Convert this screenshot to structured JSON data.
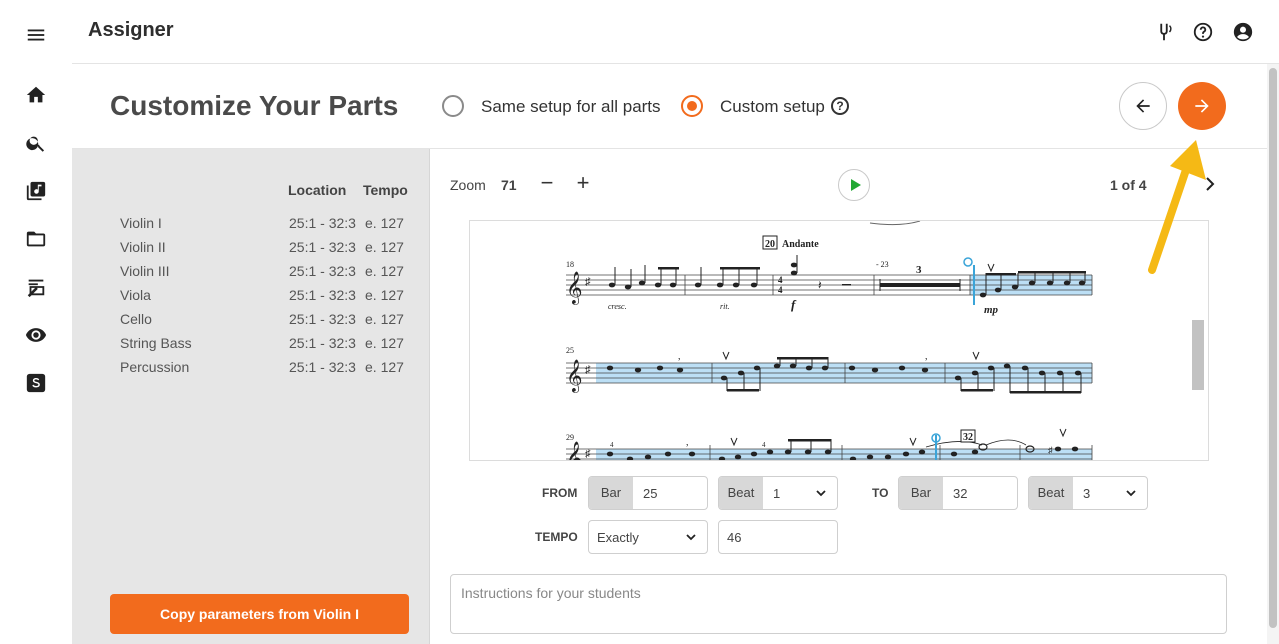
{
  "app": {
    "title": "Assigner"
  },
  "page": {
    "title": "Customize Your Parts"
  },
  "setup": {
    "option_same": "Same setup for all parts",
    "option_custom": "Custom setup",
    "selected": "custom",
    "help_glyph": "?"
  },
  "parts_table": {
    "headers": {
      "location": "Location",
      "tempo": "Tempo"
    },
    "rows": [
      {
        "name": "Violin I",
        "location": "25:1 - 32:3",
        "tempo": "e. 127"
      },
      {
        "name": "Violin II",
        "location": "25:1 - 32:3",
        "tempo": "e. 127"
      },
      {
        "name": "Violin III",
        "location": "25:1 - 32:3",
        "tempo": "e. 127"
      },
      {
        "name": "Viola",
        "location": "25:1 - 32:3",
        "tempo": "e. 127"
      },
      {
        "name": "Cello",
        "location": "25:1 - 32:3",
        "tempo": "e. 127"
      },
      {
        "name": "String Bass",
        "location": "25:1 - 32:3",
        "tempo": "e. 127"
      },
      {
        "name": "Percussion",
        "location": "25:1 - 32:3",
        "tempo": "e. 127"
      }
    ]
  },
  "copy_button": "Copy parameters from Violin I",
  "viewer": {
    "zoom_label": "Zoom",
    "zoom_value": "71",
    "minus": "−",
    "plus": "+",
    "page_indicator": "1 of 4"
  },
  "score": {
    "rehearsal_20": "20",
    "tempo_marking": "Andante",
    "measure_18": "18",
    "measure_25": "25",
    "measure_29": "29",
    "rest_range": "- 23",
    "multirest_count": "3",
    "rehearsal_32": "32",
    "dyn_cresc": "cresc.",
    "dyn_rit": "rit.",
    "dyn_f": "f",
    "dyn_mp": "mp"
  },
  "form": {
    "from_label": "FROM",
    "to_label": "TO",
    "tempo_label": "TEMPO",
    "bar_tag": "Bar",
    "beat_tag": "Beat",
    "from_bar": "25",
    "from_beat": "1",
    "to_bar": "32",
    "to_beat": "3",
    "tempo_mode": "Exactly",
    "tempo_value": "46",
    "instructions_placeholder": "Instructions for your students"
  },
  "colors": {
    "accent": "#f26b1d",
    "play": "#22a834",
    "highlight": "#bcdff5",
    "annotation": "#f5b915"
  },
  "icons": {
    "rail": [
      "menu-icon",
      "home-icon",
      "search-icon",
      "music-library-icon",
      "folder-icon",
      "assignment-icon",
      "eye-icon",
      "s-logo-icon"
    ],
    "header": [
      "tuning-fork-icon",
      "help-icon",
      "account-icon"
    ]
  }
}
